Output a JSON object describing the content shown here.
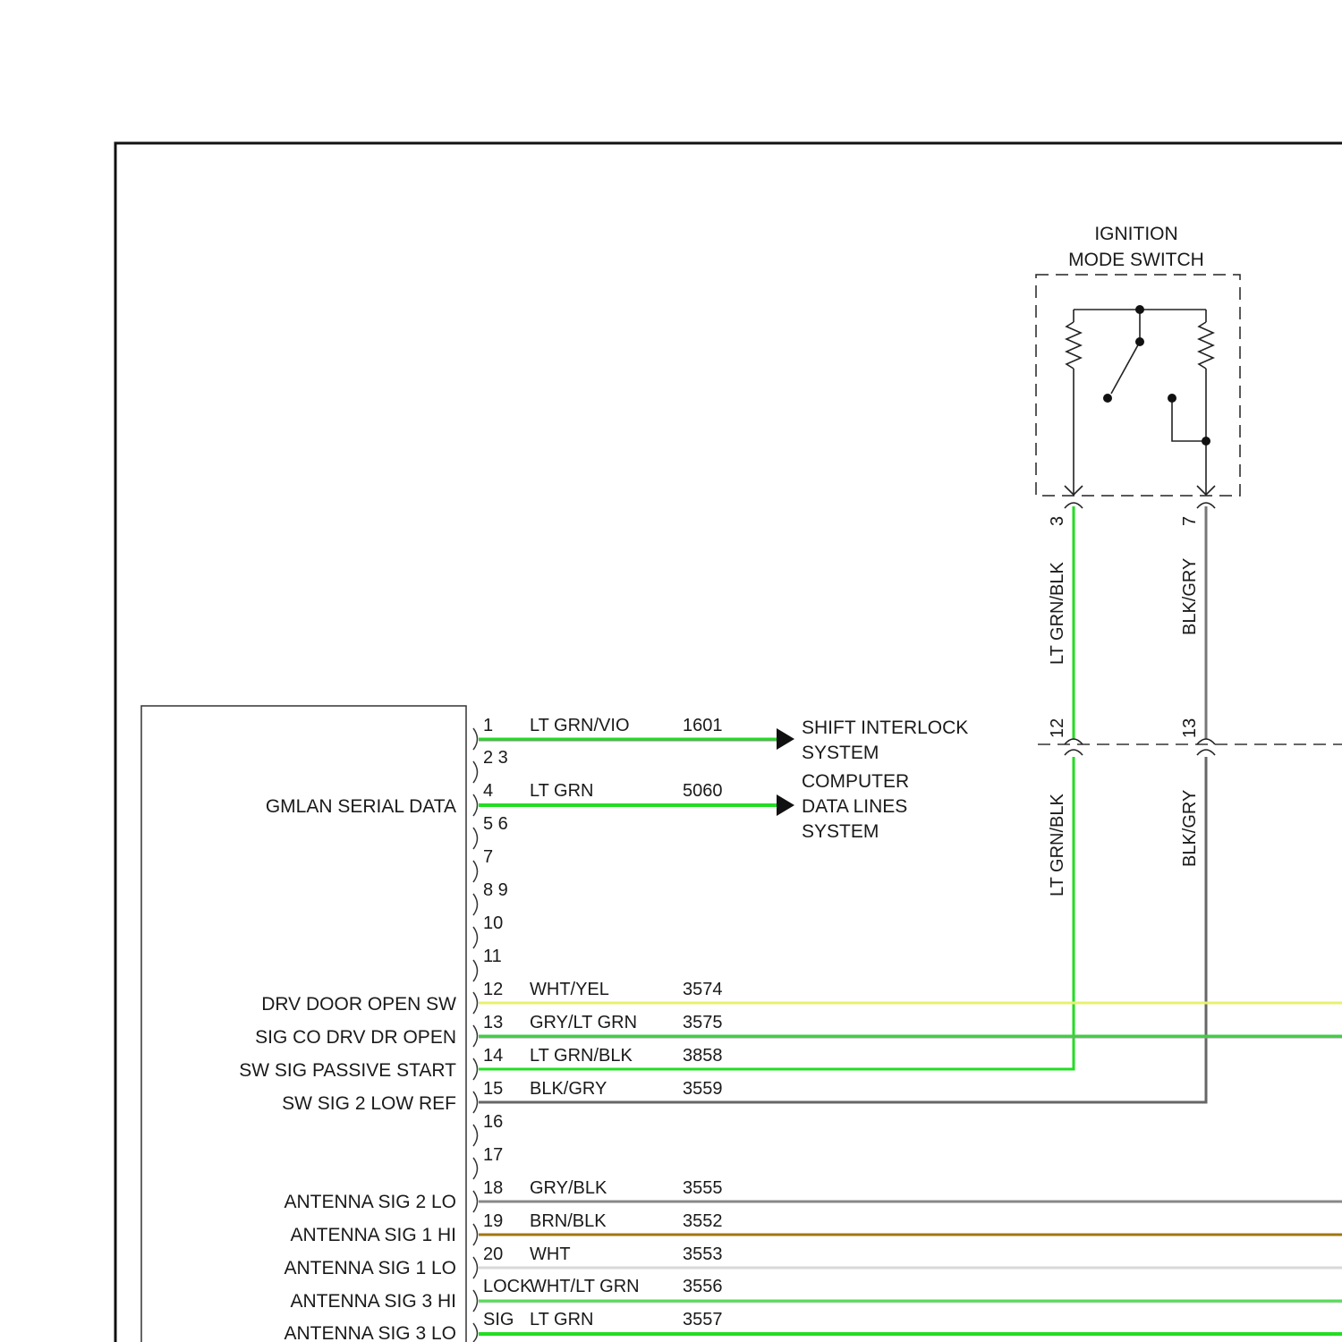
{
  "ignition_switch": {
    "title_line1": "IGNITION",
    "title_line2": "MODE SWITCH",
    "pin_a": "3",
    "pin_b": "7",
    "wire_a_color_upper": "LT GRN/BLK",
    "wire_b_color_upper": "BLK/GRY",
    "connector_a_pin": "12",
    "connector_b_pin": "13",
    "wire_a_color_lower": "LT GRN/BLK",
    "wire_b_color_lower": "BLK/GRY"
  },
  "module": {
    "labels": {
      "gmlan": "GMLAN SERIAL DATA",
      "drv_door": "DRV DOOR OPEN SW",
      "sig_co": "SIG CO DRV DR OPEN",
      "passive_start": "SW SIG PASSIVE START",
      "low_ref": "SW SIG 2 LOW REF",
      "ant2lo": "ANTENNA SIG 2 LO",
      "ant1hi": "ANTENNA SIG 1 HI",
      "ant1lo": "ANTENNA SIG 1 LO",
      "ant3hi": "ANTENNA SIG 3 HI",
      "ant3lo": "ANTENNA SIG 3 LO"
    },
    "pins": [
      {
        "num": "1",
        "color": "LT GRN/VIO",
        "circuit": "1601"
      },
      {
        "num": "2 3",
        "color": "",
        "circuit": ""
      },
      {
        "num": "4",
        "color": "LT GRN",
        "circuit": "5060"
      },
      {
        "num": "5 6",
        "color": "",
        "circuit": ""
      },
      {
        "num": "7",
        "color": "",
        "circuit": ""
      },
      {
        "num": "8 9",
        "color": "",
        "circuit": ""
      },
      {
        "num": "10",
        "color": "",
        "circuit": ""
      },
      {
        "num": "11",
        "color": "",
        "circuit": ""
      },
      {
        "num": "12",
        "color": "WHT/YEL",
        "circuit": "3574"
      },
      {
        "num": "13",
        "color": "GRY/LT GRN",
        "circuit": "3575"
      },
      {
        "num": "14",
        "color": "LT GRN/BLK",
        "circuit": "3858"
      },
      {
        "num": "15",
        "color": "BLK/GRY",
        "circuit": "3559"
      },
      {
        "num": "16",
        "color": "",
        "circuit": ""
      },
      {
        "num": "17",
        "color": "",
        "circuit": ""
      },
      {
        "num": "18",
        "color": "GRY/BLK",
        "circuit": "3555"
      },
      {
        "num": "19",
        "color": "BRN/BLK",
        "circuit": "3552"
      },
      {
        "num": "20",
        "color": "WHT",
        "circuit": "3553"
      },
      {
        "num": "LOCK",
        "color": "WHT/LT GRN",
        "circuit": "3556"
      },
      {
        "num": "SIG",
        "color": "LT GRN",
        "circuit": "3557"
      }
    ]
  },
  "destinations": {
    "shift_line1": "SHIFT INTERLOCK",
    "shift_line2": "SYSTEM",
    "computer_line1": "COMPUTER",
    "computer_line2": "DATA LINES",
    "computer_line3": "SYSTEM"
  },
  "colors": {
    "lt_grn": "#22dd22",
    "gray": "#888888",
    "dark_gray": "#555555",
    "wht_yel": "#e8f070",
    "brn": "#a0760a",
    "black": "#1a1a1a"
  }
}
